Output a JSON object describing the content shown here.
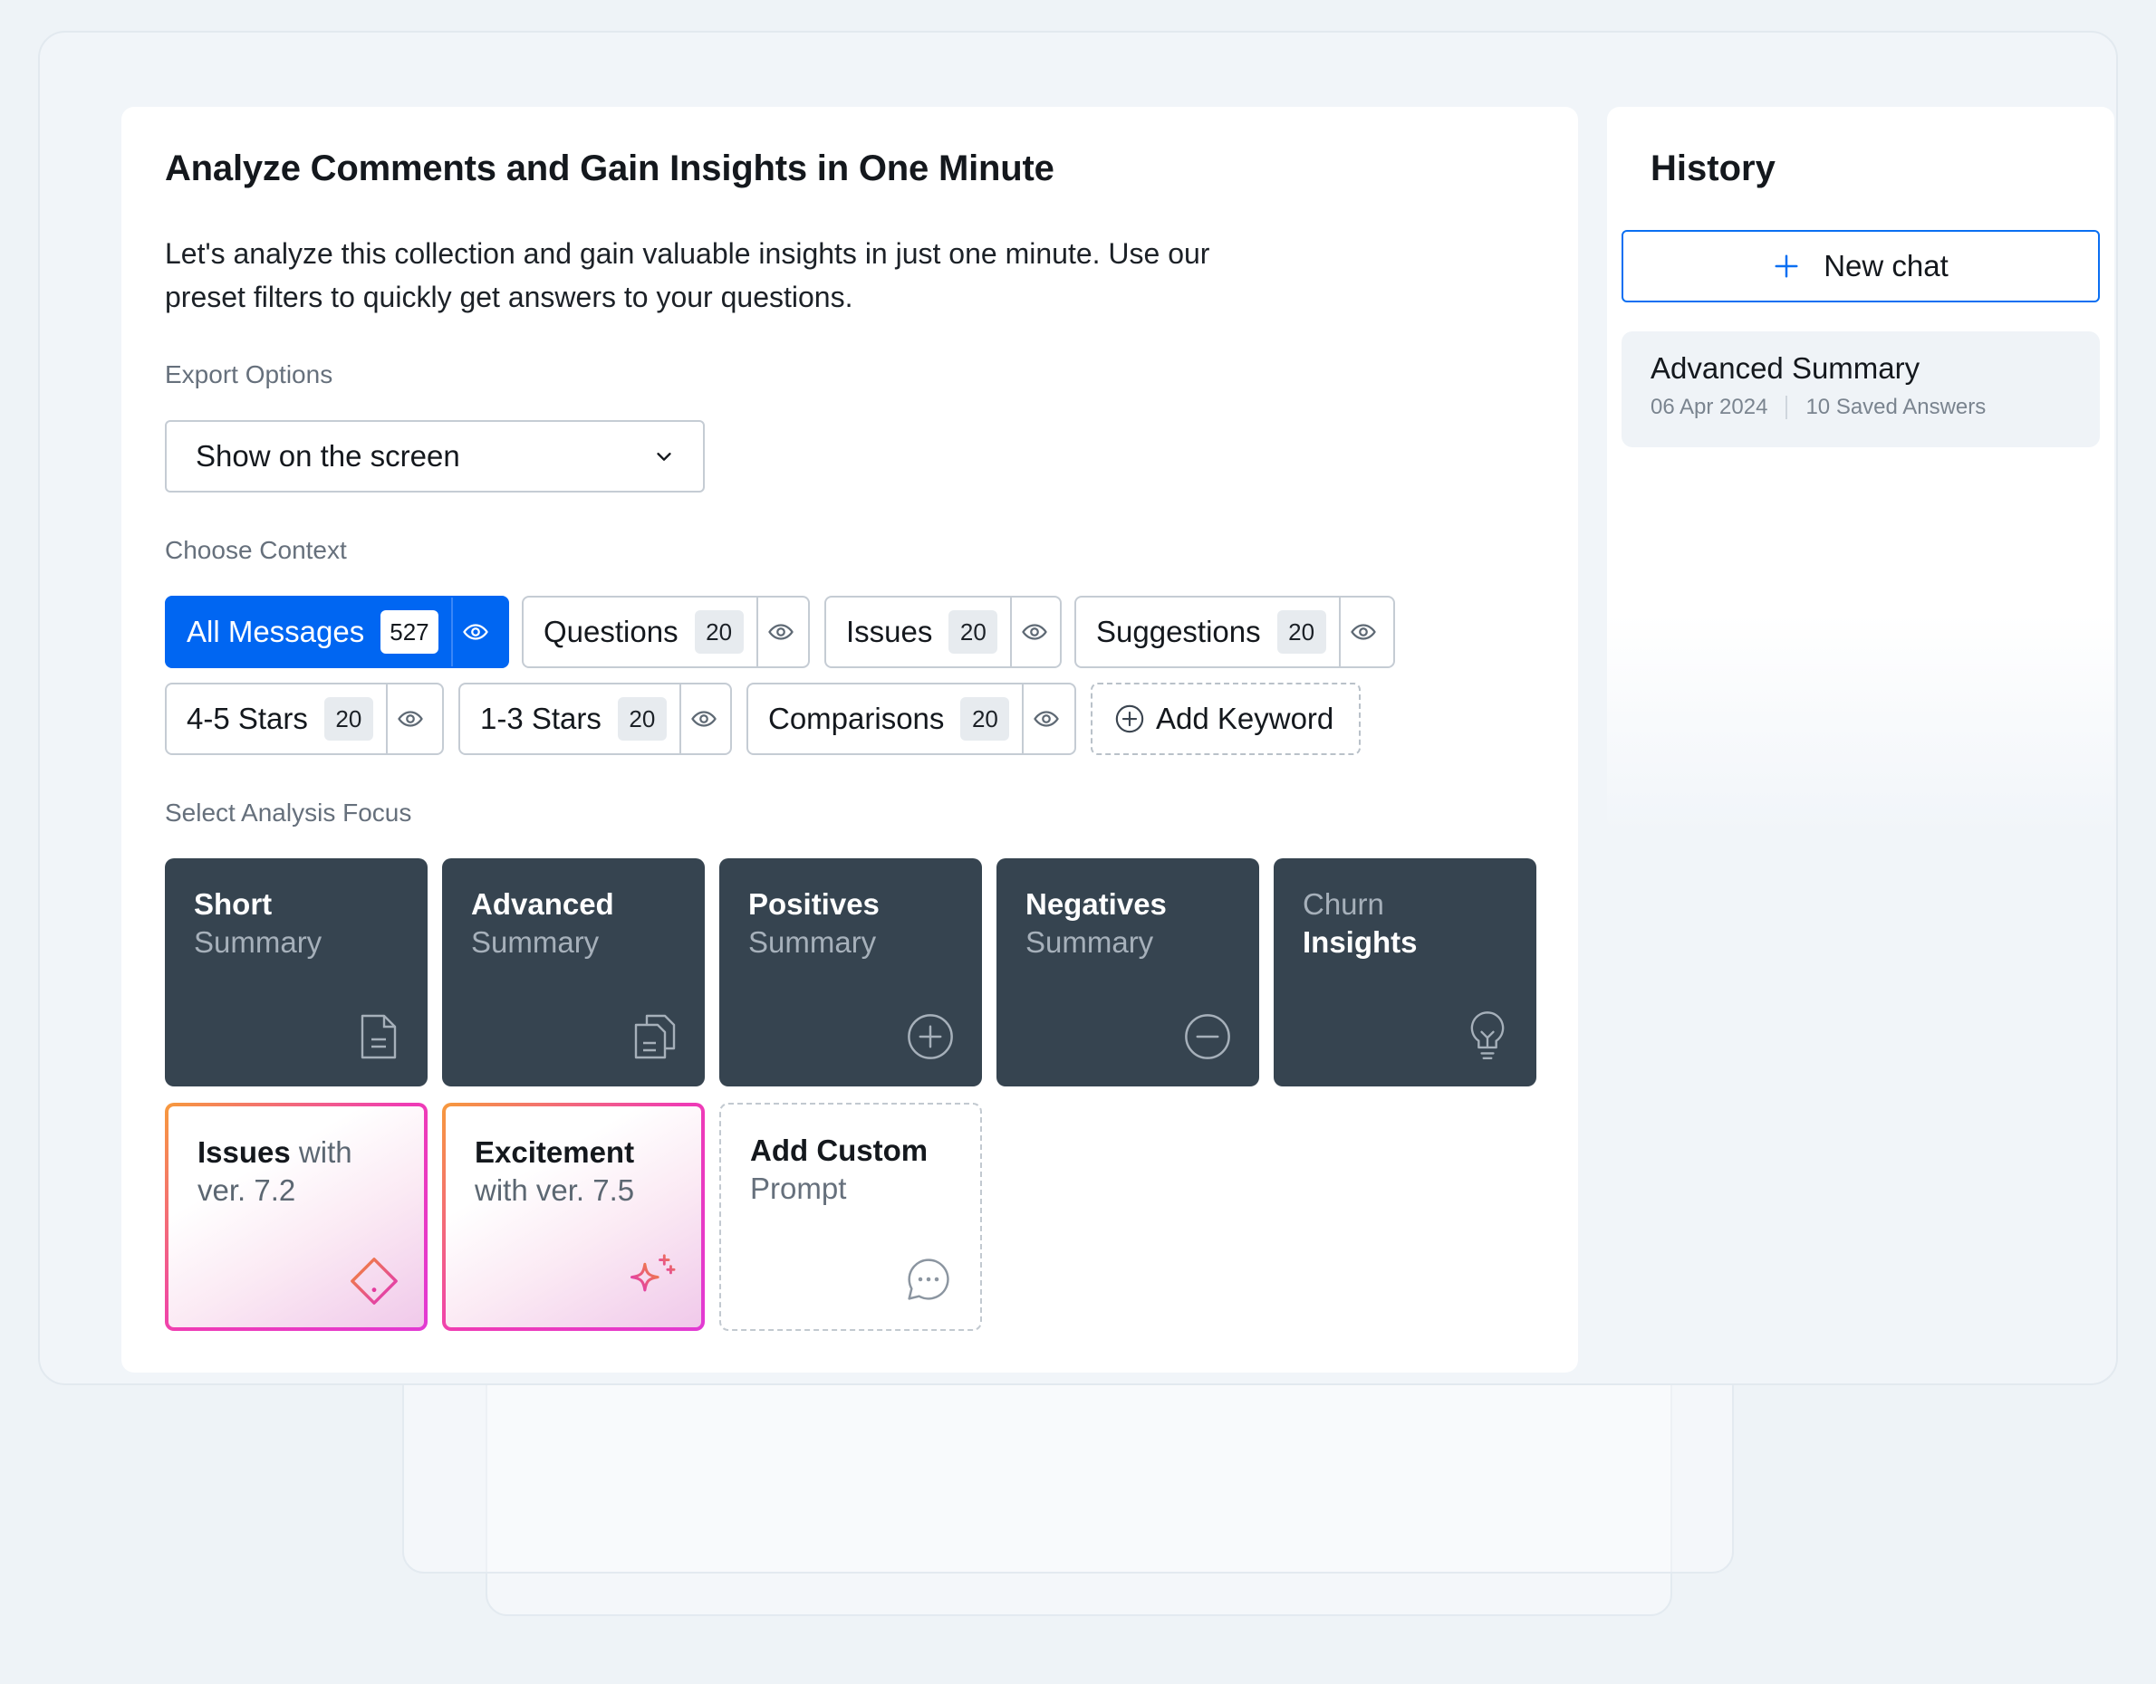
{
  "main": {
    "title": "Analyze Comments and Gain Insights in One Minute",
    "description": "Let's analyze this collection and gain valuable insights in just one minute. Use our preset filters to quickly get answers to your questions.",
    "export_label": "Export Options",
    "export_value": "Show on the screen",
    "context_label": "Choose Context",
    "contexts": [
      {
        "label": "All Messages",
        "count": "527",
        "active": true
      },
      {
        "label": "Questions",
        "count": "20"
      },
      {
        "label": "Issues",
        "count": "20"
      },
      {
        "label": "Suggestions",
        "count": "20"
      },
      {
        "label": "4-5 Stars",
        "count": "20"
      },
      {
        "label": "1-3 Stars",
        "count": "20"
      },
      {
        "label": "Comparisons",
        "count": "20"
      }
    ],
    "add_keyword": "Add Keyword",
    "focus_label": "Select Analysis Focus",
    "focus": [
      {
        "strong": "Short",
        "rest": "Summary",
        "icon": "document-icon"
      },
      {
        "strong": "Advanced",
        "rest": "Summary",
        "icon": "documents-icon"
      },
      {
        "strong": "Positives",
        "rest": "Summary",
        "icon": "plus-circle-icon"
      },
      {
        "strong": "Negatives",
        "rest": "Summary",
        "icon": "minus-circle-icon"
      },
      {
        "light": "Churn",
        "strong": "Insights",
        "icon": "lightbulb-icon"
      },
      {
        "strong": "Issues",
        "rest1": " with",
        "rest2": "ver. 7.2",
        "icon": "warning-diamond-icon"
      },
      {
        "strong": "Excitement",
        "rest": "with ver. 7.5",
        "icon": "sparkles-icon"
      },
      {
        "strong": "Add Custom",
        "rest": "Prompt",
        "icon": "chat-bubble-icon"
      }
    ]
  },
  "history": {
    "title": "History",
    "new_chat": "New chat",
    "items": [
      {
        "name": "Advanced Summary",
        "date": "06 Apr 2024",
        "saved": "10 Saved Answers"
      }
    ]
  },
  "colors": {
    "accent": "#0066f2",
    "tile_dark": "#364450"
  }
}
